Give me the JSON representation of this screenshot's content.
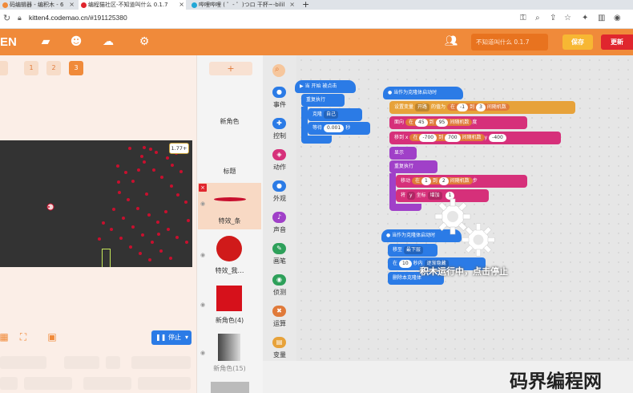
{
  "browser": {
    "tabs": [
      {
        "label": "码编辑器 - 编积木 - 6",
        "favicon_color": "#f08a3a"
      },
      {
        "label": "编程猫社区-不知道叫什么 0.1.7",
        "favicon_color": "#e0262e"
      },
      {
        "label": "哔哩哔哩 ( ゜- ゜)つロ 干杯~-bilil",
        "favicon_color": "#22a7d6"
      }
    ],
    "new_tab": "+",
    "url_host": "kitten4.codemao.cn",
    "url_path": "/#191125380"
  },
  "header": {
    "brand": "EN",
    "work_title": "不知道叫什么 0.1.7",
    "save_label": "保存",
    "update_label": "更新"
  },
  "stage": {
    "scene_tabs": [
      "1",
      "2",
      "3"
    ],
    "active_scene": "3",
    "fps_badge": "1.77+",
    "stop_label": "❚❚ 停止",
    "dots": [
      [
        178,
        182
      ],
      [
        186,
        184
      ],
      [
        193,
        188
      ],
      [
        160,
        183
      ],
      [
        207,
        195
      ],
      [
        213,
        204
      ],
      [
        218,
        189
      ],
      [
        175,
        193
      ],
      [
        145,
        205
      ],
      [
        155,
        213
      ],
      [
        164,
        224
      ],
      [
        178,
        200
      ],
      [
        190,
        210
      ],
      [
        200,
        219
      ],
      [
        212,
        230
      ],
      [
        220,
        241
      ],
      [
        230,
        250
      ],
      [
        147,
        238
      ],
      [
        158,
        247
      ],
      [
        170,
        258
      ],
      [
        184,
        266
      ],
      [
        195,
        275
      ],
      [
        208,
        284
      ],
      [
        219,
        294
      ],
      [
        231,
        300
      ],
      [
        140,
        259
      ],
      [
        152,
        270
      ],
      [
        164,
        281
      ],
      [
        176,
        291
      ],
      [
        188,
        300
      ],
      [
        199,
        311
      ],
      [
        211,
        320
      ],
      [
        137,
        284
      ],
      [
        149,
        295
      ],
      [
        161,
        306
      ],
      [
        173,
        314
      ],
      [
        185,
        322
      ],
      [
        196,
        290
      ],
      [
        205,
        262
      ],
      [
        181,
        240
      ],
      [
        224,
        212
      ],
      [
        171,
        210
      ],
      [
        146,
        225
      ],
      [
        233,
        273
      ],
      [
        127,
        276
      ],
      [
        122,
        296
      ]
    ]
  },
  "sprites": [
    {
      "name": "新角色",
      "selected": false,
      "visual": "blank"
    },
    {
      "name": "标题",
      "selected": false,
      "visual": "blank"
    },
    {
      "name": "特效_条",
      "selected": true,
      "visual": "bar"
    },
    {
      "name": "特效_我…",
      "selected": false,
      "visual": "circle"
    },
    {
      "name": "新角色(4)",
      "selected": false,
      "visual": "square"
    },
    {
      "name": "新角色(15)",
      "selected": false,
      "visual": "gradient"
    }
  ],
  "add_sprite": "+",
  "categories": [
    {
      "label": "事件",
      "color": "#2b7be6"
    },
    {
      "label": "控制",
      "color": "#2b7be6"
    },
    {
      "label": "动作",
      "color": "#d6307a"
    },
    {
      "label": "外观",
      "color": "#2b7be6"
    },
    {
      "label": "声音",
      "color": "#a040c8"
    },
    {
      "label": "画笔",
      "color": "#2ea05a"
    },
    {
      "label": "侦测",
      "color": "#2ea05a"
    },
    {
      "label": "运算",
      "color": "#e07a3a"
    },
    {
      "label": "变量",
      "color": "#e7a23a"
    }
  ],
  "blocks": {
    "when_start": "当 开始 被点击",
    "repeat_forever": "重复执行",
    "clone": "克隆",
    "clone_target": "自己",
    "wait": "等待",
    "wait_value": "0.001",
    "wait_unit": "秒",
    "when_clone": "当作为克隆体启动时",
    "set_var": "设置变量",
    "set_var_name": "开路",
    "set_var_mid": "的值为",
    "rand_from": "在",
    "rand_a1": "-1",
    "rand_to": "到",
    "rand_b1": "3",
    "rand_end": "间随机数",
    "face": "面向",
    "face_a": "45",
    "face_b": "95",
    "degree": "度",
    "move_to_x": "移到 x",
    "x_a": "-700",
    "x_b": "700",
    "move_to_y": "y",
    "y_val": "-400",
    "show": "显示",
    "repeat2": "重复执行",
    "move": "移动",
    "move_a": "1",
    "move_b": "2",
    "step": "步",
    "change": "将",
    "change_axis": "y",
    "coord": "坐标",
    "increase": "增加",
    "inc_val": "1",
    "when_clone2": "当作为克隆体启动时",
    "move_to": "移至",
    "move_to_target": "最下层",
    "in": "在",
    "in_val": "10",
    "sec_inner": "秒内",
    "fade": "逐渐隐藏",
    "delete_clone": "删除本克隆体"
  },
  "running_text": "积木运行中，点击停止",
  "watermark": "码界编程网"
}
